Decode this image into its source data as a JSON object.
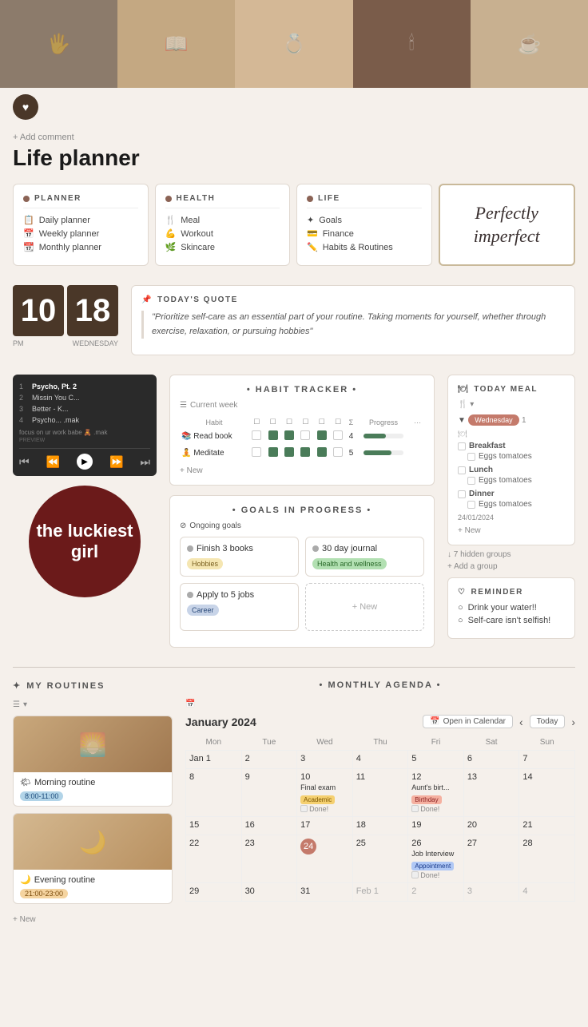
{
  "hero": {
    "images": [
      "img1",
      "img2",
      "img3",
      "img4",
      "img5"
    ]
  },
  "profile": {
    "add_comment": "+ Add comment"
  },
  "page": {
    "title": "Life planner"
  },
  "nav": {
    "planner": {
      "title": "PLANNER",
      "items": [
        "Daily planner",
        "Weekly planner",
        "Monthly planner"
      ]
    },
    "health": {
      "title": "HEALTH",
      "items": [
        "Meal",
        "Workout",
        "Skincare"
      ]
    },
    "life": {
      "title": "LIFE",
      "items": [
        "Goals",
        "Finance",
        "Habits & Routines"
      ]
    },
    "special": {
      "text": "Perfectly imperfect"
    }
  },
  "clock": {
    "hour": "10",
    "minute": "18",
    "period": "PM",
    "day": "WEDNESDAY"
  },
  "quote": {
    "title": "TODAY'S QUOTE",
    "text": "\"Prioritize self-care as an essential part of your routine. Taking moments for yourself, whether through exercise, relaxation, or pursuing hobbies\""
  },
  "habit_tracker": {
    "title": "• HABIT TRACKER •",
    "subtitle": "Current week",
    "columns": [
      "Habit",
      "☐",
      "☐",
      "☐",
      "☐",
      "☐",
      "☐",
      "Σ",
      "Progress"
    ],
    "rows": [
      {
        "name": "Read book",
        "checks": [
          false,
          true,
          true,
          false,
          true,
          false
        ],
        "sum": 4,
        "progress": 57
      },
      {
        "name": "Meditate",
        "checks": [
          false,
          true,
          true,
          true,
          true,
          false
        ],
        "sum": 5,
        "progress": 71
      }
    ],
    "new_label": "+ New"
  },
  "goals": {
    "title": "• GOALS IN PROGRESS •",
    "ongoing_label": "Ongoing goals",
    "items": [
      {
        "name": "Finish 3 books",
        "tag": "Hobbies",
        "tag_class": "tag-hobbies"
      },
      {
        "name": "30 day journal",
        "tag": "Health and wellness",
        "tag_class": "tag-health"
      },
      {
        "name": "Apply to 5 jobs",
        "tag": "Career",
        "tag_class": "tag-career"
      }
    ],
    "new_label": "+ New"
  },
  "today_meal": {
    "title": "TODAY MEAL",
    "icon": "🍽",
    "day": "Wednesday",
    "day_num": "1",
    "date": "24/01/2024",
    "sections": [
      {
        "title": "Breakfast",
        "items": [
          "Eggs tomatoes"
        ]
      },
      {
        "title": "Lunch",
        "items": [
          "Eggs tomatoes"
        ]
      },
      {
        "title": "Dinner",
        "items": [
          "Eggs tomatoes"
        ]
      }
    ],
    "new_label": "+ New",
    "hidden_groups": "↓ 7 hidden groups",
    "add_group": "+ Add a group"
  },
  "reminder": {
    "title": "REMINDER",
    "items": [
      "Drink your water!!",
      "Self-care isn't selfish!"
    ]
  },
  "luckiest_girl": {
    "text": "the luckiest girl"
  },
  "routines": {
    "title": "MY ROUTINES",
    "items": [
      {
        "name": "Morning routine",
        "time": "8:00-11:00",
        "time_class": "time-morning"
      },
      {
        "name": "Evening routine",
        "time": "21:00-23:00",
        "time_class": "time-evening"
      }
    ],
    "new_label": "+ New"
  },
  "monthly_agenda": {
    "title": "• MONTHLY AGENDA •",
    "month": "January 2024",
    "open_calendar": "Open in Calendar",
    "today_btn": "Today",
    "days": [
      "Mon",
      "Tue",
      "Wed",
      "Thu",
      "Fri",
      "Sat",
      "Sun"
    ],
    "weeks": [
      [
        "Jan 1",
        "2",
        "3",
        "4",
        "5",
        "6",
        "7"
      ],
      [
        "8",
        "9",
        "10",
        "11",
        "12",
        "13",
        "14"
      ],
      [
        "15",
        "16",
        "17",
        "18",
        "19",
        "20",
        "21"
      ],
      [
        "22",
        "23",
        "24",
        "25",
        "26",
        "27",
        "28"
      ],
      [
        "29",
        "30",
        "31",
        "Feb 1",
        "2",
        "3",
        "4"
      ]
    ],
    "events": {
      "10": {
        "name": "Final exam",
        "tag": "Academic",
        "tag_class": "event-academic",
        "done": true
      },
      "12": {
        "name": "Aunt's birt...",
        "tag": "Birthday",
        "tag_class": "event-birthday",
        "done": true
      },
      "26": {
        "name": "Job Interview",
        "tag": "Appointment",
        "tag_class": "event-appointment",
        "done": true
      }
    },
    "today_date": "24"
  }
}
